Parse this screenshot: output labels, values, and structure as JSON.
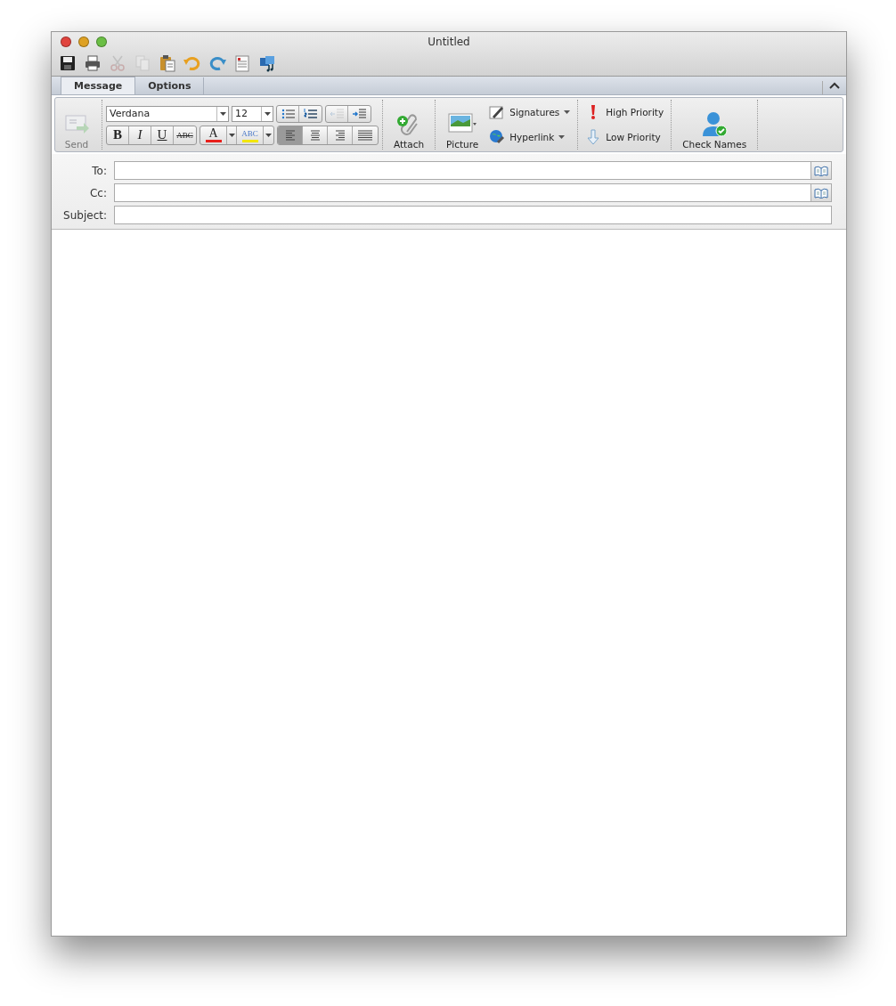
{
  "window": {
    "title": "Untitled"
  },
  "toolbar": [
    {
      "kind": "save"
    },
    {
      "kind": "print"
    },
    {
      "kind": "cut",
      "disabled": true
    },
    {
      "kind": "copy",
      "disabled": true
    },
    {
      "kind": "paste",
      "disabled": false
    },
    {
      "kind": "undo",
      "disabled": false
    },
    {
      "kind": "redo",
      "disabled": false
    },
    {
      "kind": "form",
      "disabled": false
    },
    {
      "kind": "media",
      "disabled": false
    }
  ],
  "tabs": [
    {
      "label": "Message",
      "selected": true
    },
    {
      "label": "Options",
      "selected": false
    }
  ],
  "ribbon": {
    "send": {
      "label": "Send",
      "disabled": true
    },
    "font": {
      "value": "Verdana"
    },
    "size": {
      "value": "12"
    },
    "lists": [
      {
        "kind": "bullets",
        "disabled": false
      },
      {
        "kind": "numbers",
        "disabled": false
      },
      {
        "kind": "outdent",
        "disabled": true
      },
      {
        "kind": "indent",
        "disabled": false
      }
    ],
    "styles": [
      {
        "kind": "bold",
        "label": "B"
      },
      {
        "kind": "italic",
        "label": "I"
      },
      {
        "kind": "underline",
        "label": "U"
      },
      {
        "kind": "strike",
        "label": "ABC"
      }
    ],
    "font_color": {
      "label": "A",
      "color": "#e8201c"
    },
    "highlight": {
      "label": "ABC",
      "color": "#f2e600"
    },
    "align": [
      {
        "kind": "left",
        "selected": true
      },
      {
        "kind": "center",
        "selected": false
      },
      {
        "kind": "right",
        "selected": false
      },
      {
        "kind": "justify",
        "selected": false
      }
    ],
    "attach": {
      "label": "Attach"
    },
    "picture": {
      "label": "Picture"
    },
    "signatures": {
      "label": "Signatures"
    },
    "hyperlink": {
      "label": "Hyperlink"
    },
    "high_priority": {
      "label": "High Priority"
    },
    "low_priority": {
      "label": "Low Priority"
    },
    "check_names": {
      "label": "Check Names"
    }
  },
  "fields": [
    {
      "label": "To:",
      "address_book": true
    },
    {
      "label": "Cc:",
      "address_book": true
    },
    {
      "label": "Subject:",
      "address_book": false
    }
  ]
}
